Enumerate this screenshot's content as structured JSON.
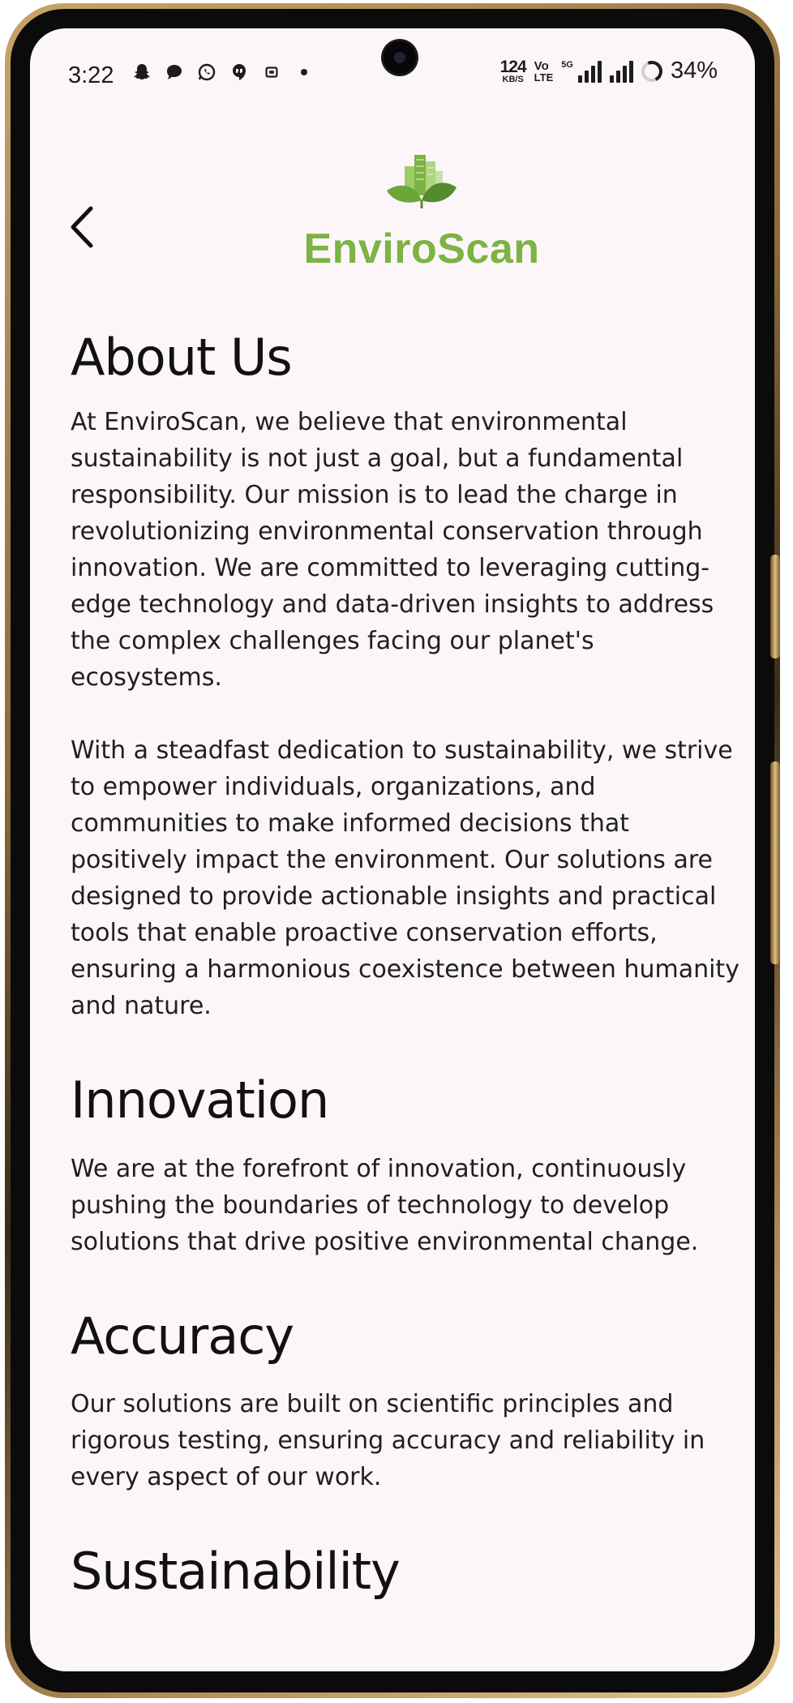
{
  "status_bar": {
    "time": "3:22",
    "net_speed_value": "124",
    "net_speed_unit": "KB/S",
    "volte_top": "Vo",
    "volte_bottom": "LTE",
    "signal_label": "5G",
    "battery_percent": "34%",
    "left_icons": [
      "snapchat-icon",
      "chat-bubble-icon",
      "whatsapp-icon",
      "hangouts-icon",
      "screenshot-icon",
      "more-dot-icon"
    ]
  },
  "header": {
    "back_icon": "chevron-left-icon",
    "logo_text": "EnviroScan",
    "logo_color_green": "#7cb342"
  },
  "about": {
    "title": "About Us",
    "paragraph1": "At EnviroScan, we believe that environmental sustainability is not just a goal, but a fundamental responsibility. Our mission is to lead the charge in revolutionizing environmental conservation through innovation. We are committed to leveraging cutting-edge technology and data-driven insights to address the complex challenges facing our planet's ecosystems.",
    "paragraph2": "With a steadfast dedication to sustainability, we strive to empower individuals, organizations, and communities to make informed decisions that positively impact the environment. Our solutions are designed to provide actionable insights and practical tools that enable proactive conservation efforts, ensuring a harmonious coexistence between humanity and nature."
  },
  "sections": [
    {
      "title": "Innovation",
      "text": "We are at the forefront of innovation, continuously pushing the boundaries of technology to develop solutions that drive positive environmental change."
    },
    {
      "title": "Accuracy",
      "text": "Our solutions are built on scientific principles and rigorous testing, ensuring accuracy and reliability in every aspect of our work."
    },
    {
      "title": "Sustainability",
      "text": ""
    }
  ]
}
